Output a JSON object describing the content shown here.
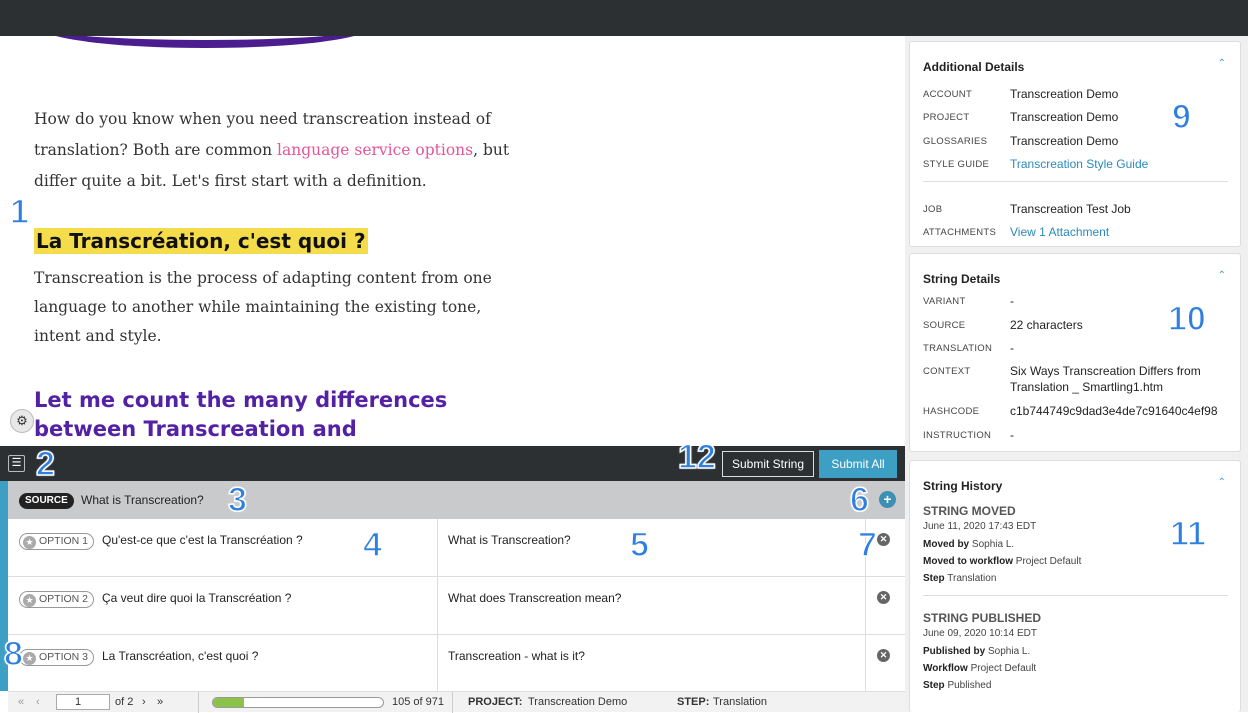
{
  "preview": {
    "para1_before": "How do you know when you need transcreation instead of translation? Both are common ",
    "para1_link": "language service options",
    "para1_after": ", but differ quite a bit. Let's first start with a definition.",
    "heading_yellow": "La Transcréation, c'est quoi ?",
    "para2": "Transcreation is the process of adapting content from one language to another while maintaining the existing tone, intent and style.",
    "heading_purple": "Let me count the many differences between Transcreation and",
    "gear_icon": "⚙"
  },
  "markers": [
    "1",
    "2",
    "3",
    "4",
    "5",
    "6",
    "7",
    "8",
    "9",
    "10",
    "11",
    "12"
  ],
  "toolbar": {
    "filter_icon": "☰",
    "submit_string": "Submit String",
    "submit_all": "Submit All"
  },
  "source": {
    "badge": "SOURCE",
    "text": "What is Transcreation?",
    "add_icon": "+"
  },
  "options": [
    {
      "label": "OPTION 1",
      "text": "Qu'est-ce que c'est la Transcréation ?",
      "translation": "What is Transcreation?"
    },
    {
      "label": "OPTION 2",
      "text": "Ça veut dire quoi la Transcréation ?",
      "translation": "What does Transcreation mean?"
    },
    {
      "label": "OPTION 3",
      "text": "La Transcréation, c'est quoi ?",
      "translation": "Transcreation - what is it?"
    }
  ],
  "option_star": "★",
  "option_delete": "✕",
  "status": {
    "first": "«",
    "prev": "‹",
    "page": "1",
    "of": "of 2",
    "next": "›",
    "last": "»",
    "progress_fraction": 0.18,
    "progress_text": "105 of 971",
    "project_label": "PROJECT:",
    "project_value": "Transcreation Demo",
    "step_label": "STEP:",
    "step_value": "Translation"
  },
  "colors": {
    "accent": "#3e9fc4",
    "purple_heading": "#5321a4",
    "link_pink": "#e5559a",
    "highlight_yellow": "#f5dc4a",
    "marker_blue": "#2f7fe0"
  },
  "additional_details": {
    "title": "Additional Details",
    "chevron": "⌃",
    "rows": [
      {
        "label": "ACCOUNT",
        "value": "Transcreation Demo"
      },
      {
        "label": "PROJECT",
        "value": "Transcreation Demo"
      },
      {
        "label": "GLOSSARIES",
        "value": "Transcreation Demo"
      },
      {
        "label": "STYLE GUIDE",
        "value": "Transcreation Style Guide"
      }
    ],
    "rows2": [
      {
        "label": "JOB",
        "value": "Transcreation Test Job"
      },
      {
        "label": "ATTACHMENTS",
        "value": "View 1 Attachment"
      }
    ]
  },
  "string_details": {
    "title": "String Details",
    "chevron": "⌃",
    "rows": [
      {
        "label": "VARIANT",
        "value": "-"
      },
      {
        "label": "SOURCE",
        "value": "22 characters"
      },
      {
        "label": "TRANSLATION",
        "value": "-"
      },
      {
        "label": "CONTEXT",
        "value": "Six Ways Transcreation Differs from Translation _ Smartling1.htm"
      },
      {
        "label": "HASHCODE",
        "value": "c1b744749c9dad3e4de7c91640c4ef98"
      },
      {
        "label": "INSTRUCTION",
        "value": "-"
      }
    ]
  },
  "string_history": {
    "title": "String History",
    "chevron": "⌃",
    "events": [
      {
        "title": "STRING MOVED",
        "date": "June 11, 2020  17:43 EDT",
        "l1_label": "Moved by",
        "l1_value": "Sophia L.",
        "l2_label": "Moved to workflow",
        "l2_value": "Project Default",
        "l3_label": "Step",
        "l3_value": "Translation"
      },
      {
        "title": "STRING PUBLISHED",
        "date": "June 09, 2020  10:14 EDT",
        "l1_label": "Published by",
        "l1_value": "Sophia L.",
        "l2_label": "Workflow",
        "l2_value": "Project Default",
        "l3_label": "Step",
        "l3_value": "Published"
      }
    ]
  }
}
